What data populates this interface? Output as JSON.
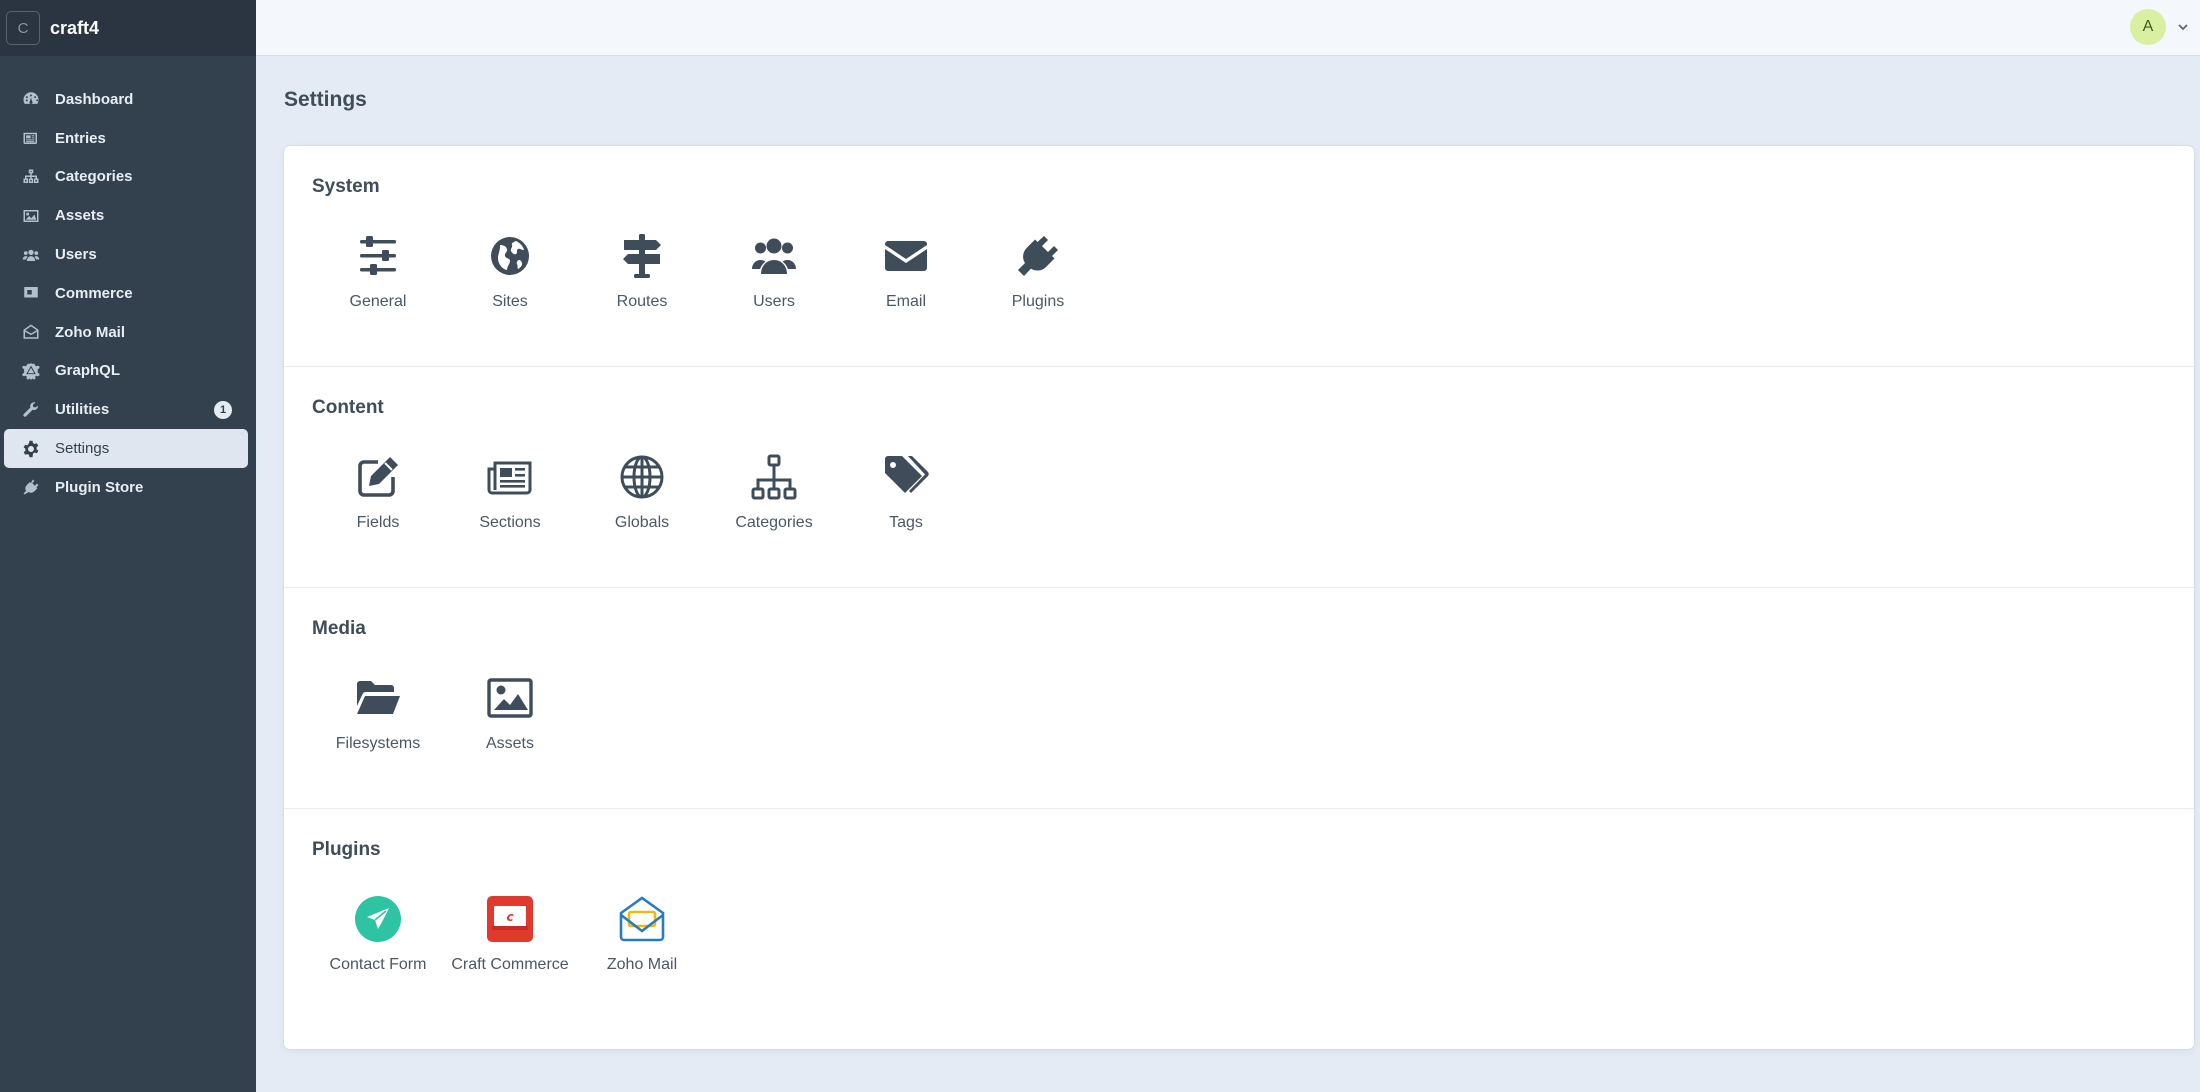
{
  "site": {
    "logo_letter": "C",
    "name": "craft4"
  },
  "nav": [
    {
      "id": "dashboard",
      "label": "Dashboard",
      "icon": "gauge-icon"
    },
    {
      "id": "entries",
      "label": "Entries",
      "icon": "newspaper-icon"
    },
    {
      "id": "categories",
      "label": "Categories",
      "icon": "sitemap-icon"
    },
    {
      "id": "assets",
      "label": "Assets",
      "icon": "image-icon"
    },
    {
      "id": "users",
      "label": "Users",
      "icon": "users-icon"
    },
    {
      "id": "commerce",
      "label": "Commerce",
      "icon": "commerce-icon"
    },
    {
      "id": "zoho-mail",
      "label": "Zoho Mail",
      "icon": "envelope-open-icon"
    },
    {
      "id": "graphql",
      "label": "GraphQL",
      "icon": "graphql-icon"
    },
    {
      "id": "utilities",
      "label": "Utilities",
      "icon": "wrench-icon",
      "badge": "1"
    },
    {
      "id": "settings",
      "label": "Settings",
      "icon": "gear-icon",
      "active": true
    },
    {
      "id": "plugin-store",
      "label": "Plugin Store",
      "icon": "plug-icon"
    }
  ],
  "user": {
    "avatar_letter": "A"
  },
  "page": {
    "title": "Settings"
  },
  "sections": [
    {
      "title": "System",
      "items": [
        {
          "label": "General",
          "icon": "sliders-icon"
        },
        {
          "label": "Sites",
          "icon": "globe-icon"
        },
        {
          "label": "Routes",
          "icon": "signpost-icon"
        },
        {
          "label": "Users",
          "icon": "users-icon"
        },
        {
          "label": "Email",
          "icon": "envelope-icon"
        },
        {
          "label": "Plugins",
          "icon": "plug-icon"
        }
      ]
    },
    {
      "title": "Content",
      "items": [
        {
          "label": "Fields",
          "icon": "pencil-square-icon"
        },
        {
          "label": "Sections",
          "icon": "newspaper-icon"
        },
        {
          "label": "Globals",
          "icon": "globe-grid-icon"
        },
        {
          "label": "Categories",
          "icon": "sitemap-icon"
        },
        {
          "label": "Tags",
          "icon": "tags-icon"
        }
      ]
    },
    {
      "title": "Media",
      "items": [
        {
          "label": "Filesystems",
          "icon": "folder-open-icon"
        },
        {
          "label": "Assets",
          "icon": "image-icon"
        }
      ]
    },
    {
      "title": "Plugins",
      "items": [
        {
          "label": "Contact Form",
          "icon": "contact-form-icon"
        },
        {
          "label": "Craft Commerce",
          "icon": "craft-commerce-icon"
        },
        {
          "label": "Zoho Mail",
          "icon": "zoho-mail-icon"
        }
      ]
    }
  ],
  "colors": {
    "sidebar": "#33404d",
    "icon": "#3f4d5a",
    "contact_form": "#2ec4a3",
    "commerce": "#e03a2e",
    "zoho_blue": "#2b7bc1",
    "zoho_yellow": "#f0b90b"
  }
}
